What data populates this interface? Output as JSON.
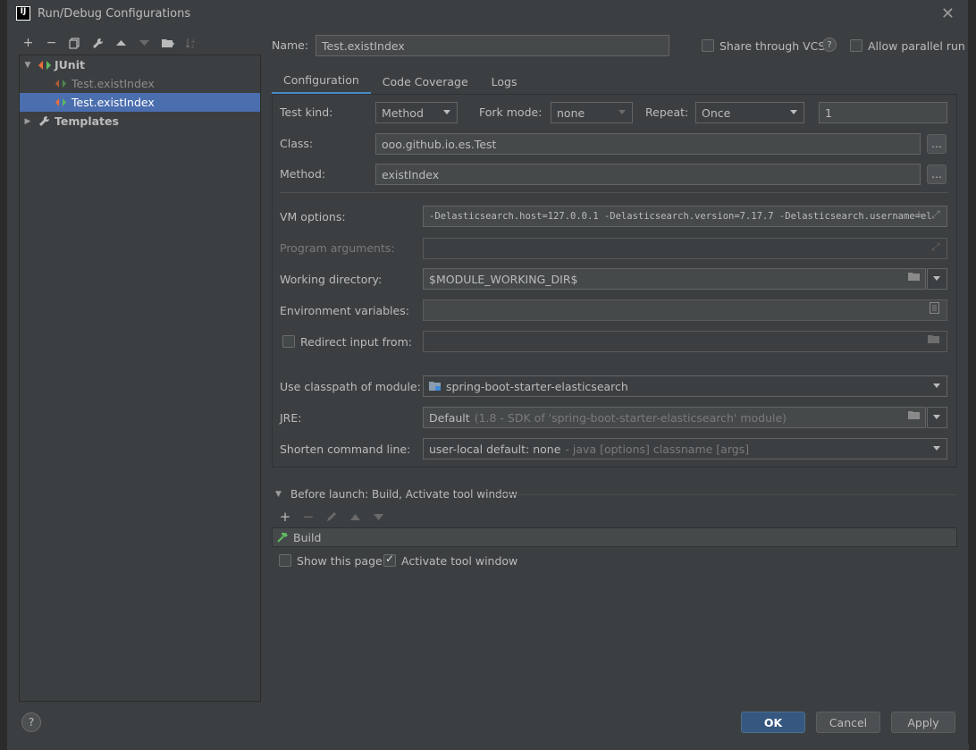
{
  "window": {
    "title": "Run/Debug Configurations"
  },
  "left_toolbar": {
    "icons": [
      "add-icon",
      "remove-icon",
      "copy-icon",
      "wrench-icon",
      "move-up-icon",
      "move-down-icon",
      "folder-add-icon",
      "sort-icon"
    ]
  },
  "tree": {
    "junit_label": "JUnit",
    "item1": "Test.existIndex",
    "item2": "Test.existIndex",
    "templates_label": "Templates"
  },
  "header": {
    "name_label": "Name:",
    "name_value": "Test.existIndex",
    "share_label": "Share through VCS",
    "parallel_label": "Allow parallel run"
  },
  "tabs": [
    "Configuration",
    "Code Coverage",
    "Logs"
  ],
  "config": {
    "test_kind_label": "Test kind:",
    "test_kind_value": "Method",
    "fork_mode_label": "Fork mode:",
    "fork_mode_value": "none",
    "repeat_label": "Repeat:",
    "repeat_value": "Once",
    "repeat_count": "1",
    "class_label": "Class:",
    "class_value": "ooo.github.io.es.Test",
    "method_label": "Method:",
    "method_value": "existIndex",
    "vm_label": "VM options:",
    "vm_value": "-Delasticsearch.host=127.0.0.1 -Delasticsearch.version=7.17.7 -Delasticsearch.username=el",
    "program_args_label": "Program arguments:",
    "working_dir_label": "Working directory:",
    "working_dir_value": "$MODULE_WORKING_DIR$",
    "env_label": "Environment variables:",
    "redirect_label": "Redirect input from:",
    "classpath_label": "Use classpath of module:",
    "classpath_value": "spring-boot-starter-elasticsearch",
    "jre_label": "JRE:",
    "jre_value": "Default",
    "jre_hint": "(1.8 - SDK of 'spring-boot-starter-elasticsearch' module)",
    "shorten_label": "Shorten command line:",
    "shorten_value": "user-local default: none",
    "shorten_hint": "- java [options] classname [args]"
  },
  "before_launch": {
    "title": "Before launch: Build, Activate tool window",
    "build_item": "Build",
    "show_page_label": "Show this page",
    "activate_label": "Activate tool window"
  },
  "buttons": {
    "ok": "OK",
    "cancel": "Cancel",
    "apply": "Apply",
    "help": "?"
  }
}
